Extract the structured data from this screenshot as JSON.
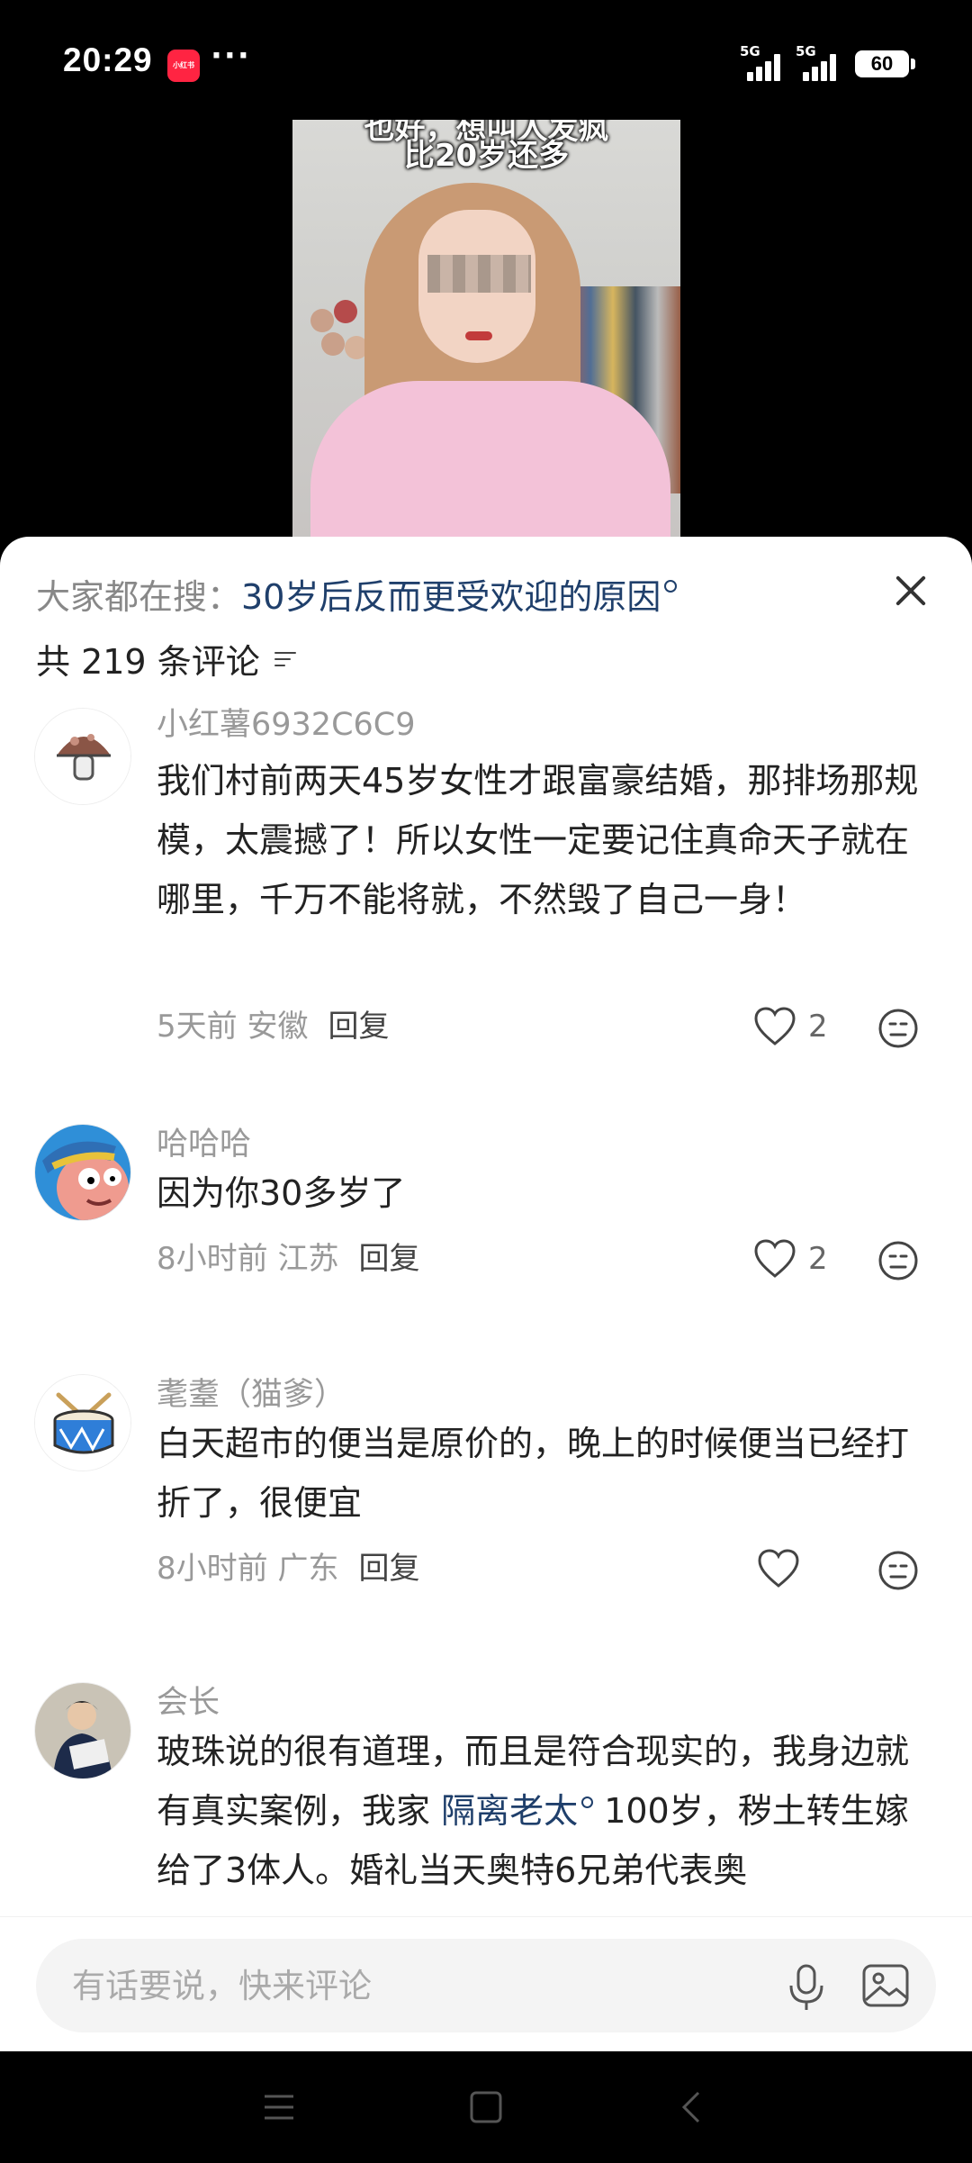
{
  "status_bar": {
    "time": "20:29",
    "app_badge": "小红书",
    "more": "···",
    "network_1": "5G",
    "network_2": "5G",
    "battery": "60"
  },
  "video": {
    "caption_top": "也好，想叫人发疯",
    "caption_main": "比20岁还多"
  },
  "sheet": {
    "search_prefix": "大家都在搜：",
    "search_term": "30岁后反而更受欢迎的原因",
    "comment_count_text": "共 219 条评论"
  },
  "comments": [
    {
      "avatar_icon": "mushroom-avatar-icon",
      "name": "小红薯6932C6C9",
      "text": "我们村前两天45岁女性才跟富豪结婚，那排场那规模，太震撼了！所以女性一定要记住真命天子就在哪里，千万不能将就，不然毁了自己一身！",
      "time_location": "5天前 安徽",
      "reply": "回复",
      "likes": "2"
    },
    {
      "avatar_icon": "cartoon-character-avatar-icon",
      "name": "哈哈哈",
      "text": "因为你30多岁了",
      "time_location": "8小时前 江苏",
      "reply": "回复",
      "likes": "2"
    },
    {
      "avatar_icon": "drum-avatar-icon",
      "name": "耄耋（猫爹）",
      "text": "白天超市的便当是原价的，晚上的时候便当已经打折了，很便宜",
      "time_location": "8小时前 广东",
      "reply": "回复",
      "likes": ""
    },
    {
      "avatar_icon": "person-photo-avatar-icon",
      "name": "会长",
      "text_before": "玻珠说的很有道理，而且是符合现实的，我身边就有真实案例，我家 ",
      "text_term": "隔离老太",
      "text_after": " 100岁，秽土转生嫁给了3体人。婚礼当天奥特6兄弟代表奥"
    }
  ],
  "input": {
    "placeholder": "有话要说，快来评论"
  },
  "colors": {
    "accent_link": "#1f3f6b",
    "app_red": "#ff2442"
  }
}
